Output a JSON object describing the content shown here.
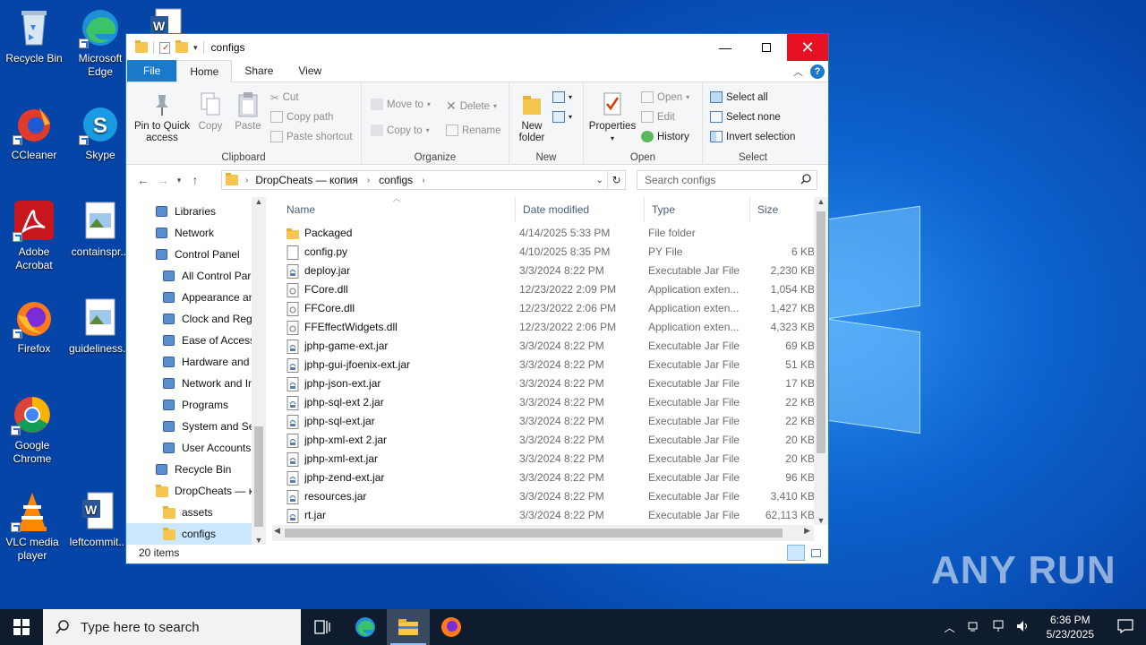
{
  "desktop": {
    "icons": [
      {
        "label": "Recycle Bin",
        "icon": "recycle-bin-icon"
      },
      {
        "label": "Microsoft Edge",
        "icon": "edge-icon"
      },
      {
        "label": "CCleaner",
        "icon": "ccleaner-icon"
      },
      {
        "label": "Skype",
        "icon": "skype-icon"
      },
      {
        "label": "Adobe Acrobat",
        "icon": "acrobat-icon"
      },
      {
        "label": "containspr...",
        "icon": "image-file-icon"
      },
      {
        "label": "Firefox",
        "icon": "firefox-icon"
      },
      {
        "label": "guideliness...",
        "icon": "image-file-icon"
      },
      {
        "label": "Google Chrome",
        "icon": "chrome-icon"
      },
      {
        "label": "VLC media player",
        "icon": "vlc-icon"
      },
      {
        "label": "leftcommit...",
        "icon": "word-doc-icon"
      }
    ],
    "watermark": "ANY RUN"
  },
  "window": {
    "title": "configs",
    "tabs": [
      "File",
      "Home",
      "Share",
      "View"
    ],
    "help": "?",
    "ribbon": {
      "clipboard": {
        "label": "Clipboard",
        "pin": "Pin to Quick access",
        "copy": "Copy",
        "paste": "Paste",
        "cut": "Cut",
        "copy_path": "Copy path",
        "paste_shortcut": "Paste shortcut"
      },
      "organize": {
        "label": "Organize",
        "move_to": "Move to",
        "copy_to": "Copy to",
        "delete": "Delete",
        "rename": "Rename"
      },
      "new": {
        "label": "New",
        "new_folder": "New folder"
      },
      "open": {
        "label": "Open",
        "properties": "Properties",
        "open": "Open",
        "edit": "Edit",
        "history": "History"
      },
      "select": {
        "label": "Select",
        "select_all": "Select all",
        "select_none": "Select none",
        "invert": "Invert selection"
      }
    },
    "address": {
      "parts": [
        "DropCheats — копия",
        "configs"
      ],
      "search_placeholder": "Search configs"
    },
    "nav": [
      {
        "label": "Libraries",
        "icon": "libraries-icon",
        "indent": 0
      },
      {
        "label": "Network",
        "icon": "network-icon",
        "indent": 0
      },
      {
        "label": "Control Panel",
        "icon": "control-panel-icon",
        "indent": 0
      },
      {
        "label": "All Control Par",
        "icon": "control-panel-icon",
        "indent": 1
      },
      {
        "label": "Appearance an",
        "icon": "appearance-icon",
        "indent": 1
      },
      {
        "label": "Clock and Regi",
        "icon": "clock-icon",
        "indent": 1
      },
      {
        "label": "Ease of Access",
        "icon": "ease-of-access-icon",
        "indent": 1
      },
      {
        "label": "Hardware and",
        "icon": "hardware-icon",
        "indent": 1
      },
      {
        "label": "Network and Ir",
        "icon": "network-internet-icon",
        "indent": 1
      },
      {
        "label": "Programs",
        "icon": "programs-icon",
        "indent": 1
      },
      {
        "label": "System and Se",
        "icon": "system-security-icon",
        "indent": 1
      },
      {
        "label": "User Accounts",
        "icon": "user-accounts-icon",
        "indent": 1
      },
      {
        "label": "Recycle Bin",
        "icon": "recycle-bin-icon",
        "indent": 0
      },
      {
        "label": "DropCheats — к",
        "icon": "folder-icon",
        "indent": 0
      },
      {
        "label": "assets",
        "icon": "folder-icon",
        "indent": 1
      },
      {
        "label": "configs",
        "icon": "folder-icon",
        "indent": 1,
        "selected": true
      }
    ],
    "columns": [
      "Name",
      "Date modified",
      "Type",
      "Size"
    ],
    "files": [
      {
        "name": "Packaged",
        "date": "4/14/2025 5:33 PM",
        "type": "File folder",
        "size": "",
        "icon": "folder-icon"
      },
      {
        "name": "config.py",
        "date": "4/10/2025 8:35 PM",
        "type": "PY File",
        "size": "6 KB",
        "icon": "text-file-icon"
      },
      {
        "name": "deploy.jar",
        "date": "3/3/2024 8:22 PM",
        "type": "Executable Jar File",
        "size": "2,230 KB",
        "icon": "jar-file-icon"
      },
      {
        "name": "FCore.dll",
        "date": "12/23/2022 2:09 PM",
        "type": "Application exten...",
        "size": "1,054 KB",
        "icon": "dll-file-icon"
      },
      {
        "name": "FFCore.dll",
        "date": "12/23/2022 2:06 PM",
        "type": "Application exten...",
        "size": "1,427 KB",
        "icon": "dll-file-icon"
      },
      {
        "name": "FFEffectWidgets.dll",
        "date": "12/23/2022 2:06 PM",
        "type": "Application exten...",
        "size": "4,323 KB",
        "icon": "dll-file-icon"
      },
      {
        "name": "jphp-game-ext.jar",
        "date": "3/3/2024 8:22 PM",
        "type": "Executable Jar File",
        "size": "69 KB",
        "icon": "jar-file-icon"
      },
      {
        "name": "jphp-gui-jfoenix-ext.jar",
        "date": "3/3/2024 8:22 PM",
        "type": "Executable Jar File",
        "size": "51 KB",
        "icon": "jar-file-icon"
      },
      {
        "name": "jphp-json-ext.jar",
        "date": "3/3/2024 8:22 PM",
        "type": "Executable Jar File",
        "size": "17 KB",
        "icon": "jar-file-icon"
      },
      {
        "name": "jphp-sql-ext 2.jar",
        "date": "3/3/2024 8:22 PM",
        "type": "Executable Jar File",
        "size": "22 KB",
        "icon": "jar-file-icon"
      },
      {
        "name": "jphp-sql-ext.jar",
        "date": "3/3/2024 8:22 PM",
        "type": "Executable Jar File",
        "size": "22 KB",
        "icon": "jar-file-icon"
      },
      {
        "name": "jphp-xml-ext 2.jar",
        "date": "3/3/2024 8:22 PM",
        "type": "Executable Jar File",
        "size": "20 KB",
        "icon": "jar-file-icon"
      },
      {
        "name": "jphp-xml-ext.jar",
        "date": "3/3/2024 8:22 PM",
        "type": "Executable Jar File",
        "size": "20 KB",
        "icon": "jar-file-icon"
      },
      {
        "name": "jphp-zend-ext.jar",
        "date": "3/3/2024 8:22 PM",
        "type": "Executable Jar File",
        "size": "96 KB",
        "icon": "jar-file-icon"
      },
      {
        "name": "resources.jar",
        "date": "3/3/2024 8:22 PM",
        "type": "Executable Jar File",
        "size": "3,410 KB",
        "icon": "jar-file-icon"
      },
      {
        "name": "rt.jar",
        "date": "3/3/2024 8:22 PM",
        "type": "Executable Jar File",
        "size": "62,113 KB",
        "icon": "jar-file-icon"
      }
    ],
    "status": "20 items"
  },
  "taskbar": {
    "search_placeholder": "Type here to search",
    "time": "6:36 PM",
    "date": "5/23/2025"
  },
  "colors": {
    "accent": "#1979ca",
    "close": "#e81123",
    "folder": "#f6c650",
    "selection": "#cce8ff"
  }
}
